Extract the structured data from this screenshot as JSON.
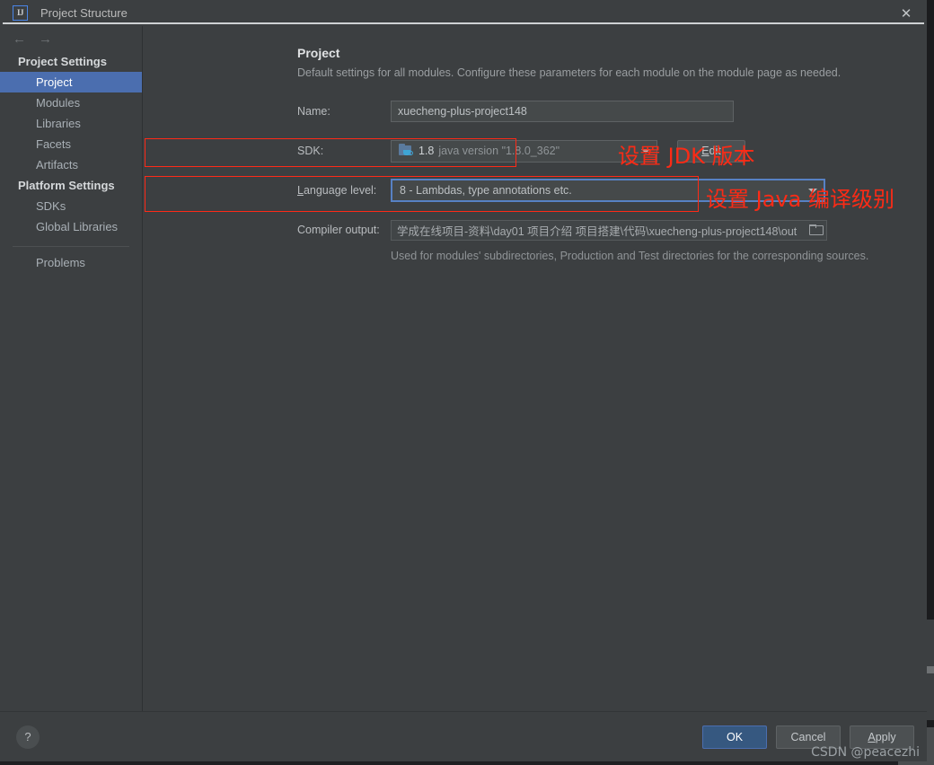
{
  "window": {
    "title": "Project Structure",
    "app_icon": "intellij-idea-icon",
    "close_icon": "close-icon",
    "back_icon": "arrow-left-icon",
    "forward_icon": "arrow-right-icon"
  },
  "sidebar": {
    "groups": [
      {
        "label": "Project Settings",
        "items": [
          {
            "label": "Project",
            "selected": true
          },
          {
            "label": "Modules",
            "selected": false
          },
          {
            "label": "Libraries",
            "selected": false
          },
          {
            "label": "Facets",
            "selected": false
          },
          {
            "label": "Artifacts",
            "selected": false
          }
        ]
      },
      {
        "label": "Platform Settings",
        "items": [
          {
            "label": "SDKs",
            "selected": false
          },
          {
            "label": "Global Libraries",
            "selected": false
          }
        ]
      }
    ],
    "problems_label": "Problems"
  },
  "main": {
    "heading": "Project",
    "description": "Default settings for all modules. Configure these parameters for each module on the module page as needed.",
    "name": {
      "label": "Name:",
      "value": "xuecheng-plus-project148"
    },
    "sdk": {
      "label": "SDK:",
      "icon": "jdk-icon",
      "version": "1.8",
      "description": "java version \"1.8.0_362\"",
      "dropdown_icon": "chevron-down-icon",
      "edit_button": "Edit",
      "edit_mnemonic": "E"
    },
    "language_level": {
      "label": "Language level:",
      "label_mnemonic": "L",
      "value": "8 - Lambdas, type annotations etc.",
      "dropdown_icon": "chevron-down-icon"
    },
    "compiler_output": {
      "label": "Compiler output:",
      "value": "学成在线项目-资料\\day01 项目介绍 项目搭建\\代码\\xuecheng-plus-project148\\out",
      "browse_icon": "folder-icon",
      "help_text": "Used for modules' subdirectories, Production and Test directories for the corresponding sources."
    }
  },
  "annotations": {
    "color": "#fb2b16",
    "jdk_note": "设置 JDK 版本",
    "java_note": "设置 Java 编译级别"
  },
  "footer": {
    "help_icon": "?",
    "ok_label": "OK",
    "cancel_label": "Cancel",
    "apply_label": "Apply",
    "apply_mnemonic": "A"
  },
  "watermark": "CSDN @peacezhi",
  "colors": {
    "dialog_bg": "#3c3f41",
    "selection": "#4b6eaf",
    "ok_button": "#365880",
    "field_bg": "#45494a",
    "focus_border": "#5781c4",
    "annotation_red": "#fb2b16"
  }
}
